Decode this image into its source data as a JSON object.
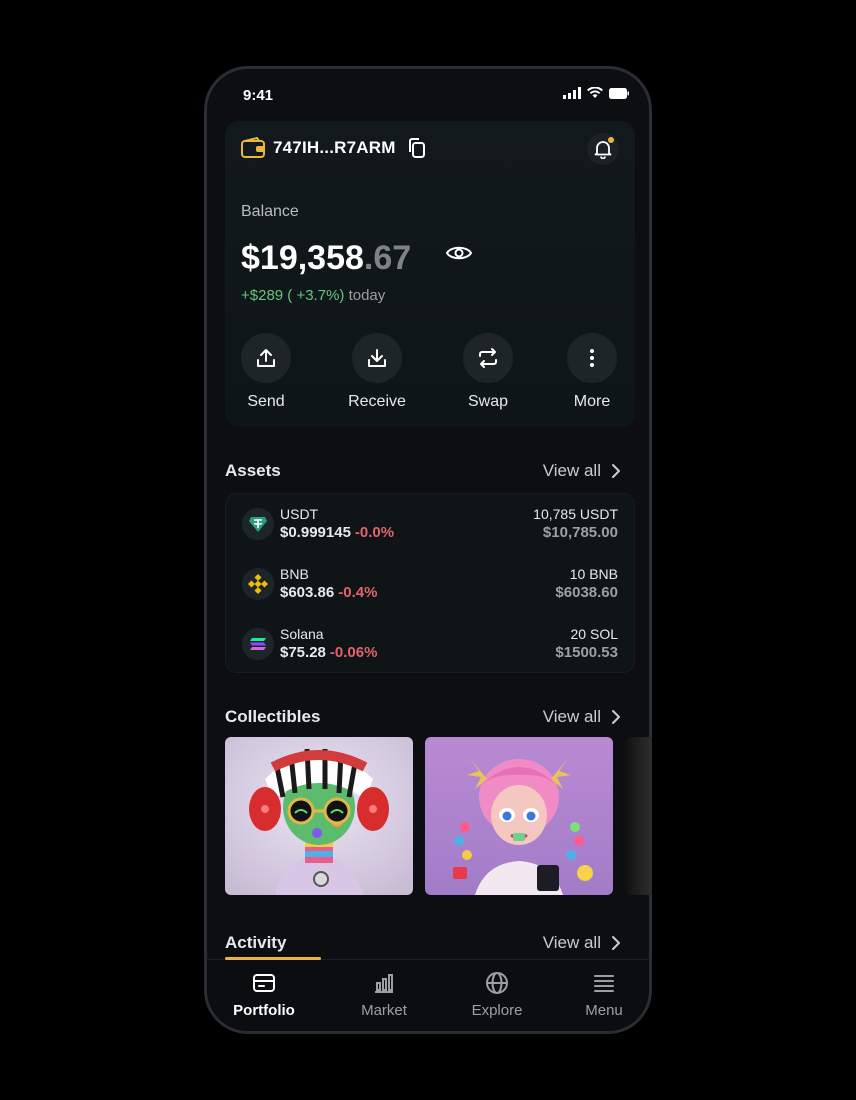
{
  "status_bar": {
    "time": "9:41"
  },
  "wallet": {
    "address": "747IH...R7ARM",
    "balance_label": "Balance",
    "balance_main": "$19,358",
    "balance_cents": ".67",
    "change": "+$289 ( +3.7%)",
    "change_period": "today"
  },
  "actions": [
    {
      "label": "Send",
      "icon": "upload-icon"
    },
    {
      "label": "Receive",
      "icon": "download-icon"
    },
    {
      "label": "Swap",
      "icon": "swap-icon"
    },
    {
      "label": "More",
      "icon": "more-vertical-icon"
    }
  ],
  "assets": {
    "title": "Assets",
    "view_all": "View all",
    "items": [
      {
        "name": "USDT",
        "price": "$0.999145",
        "change": "-0.0%",
        "amount": "10,785 USDT",
        "value": "$10,785.00",
        "icon": "tether-icon",
        "color": "#26a17b"
      },
      {
        "name": "BNB",
        "price": "$603.86",
        "change": "-0.4%",
        "amount": "10 BNB",
        "value": "$6038.60",
        "icon": "bnb-icon",
        "color": "#f0b90b"
      },
      {
        "name": "Solana",
        "price": "$75.28",
        "change": "-0.06%",
        "amount": "20 SOL",
        "value": "$1500.53",
        "icon": "solana-icon",
        "color": "#9945ff"
      }
    ]
  },
  "collectibles": {
    "title": "Collectibles",
    "view_all": "View all"
  },
  "activity": {
    "title": "Activity",
    "view_all": "View all"
  },
  "tabs": [
    {
      "label": "Portfolio",
      "icon": "wallet-card-icon",
      "active": true
    },
    {
      "label": "Market",
      "icon": "bar-chart-icon",
      "active": false
    },
    {
      "label": "Explore",
      "icon": "globe-icon",
      "active": false
    },
    {
      "label": "Menu",
      "icon": "hamburger-menu-icon",
      "active": false
    }
  ],
  "colors": {
    "accent": "#e9b73f",
    "positive": "#69c57c",
    "negative": "#e0636b",
    "background": "#0c0e12"
  }
}
